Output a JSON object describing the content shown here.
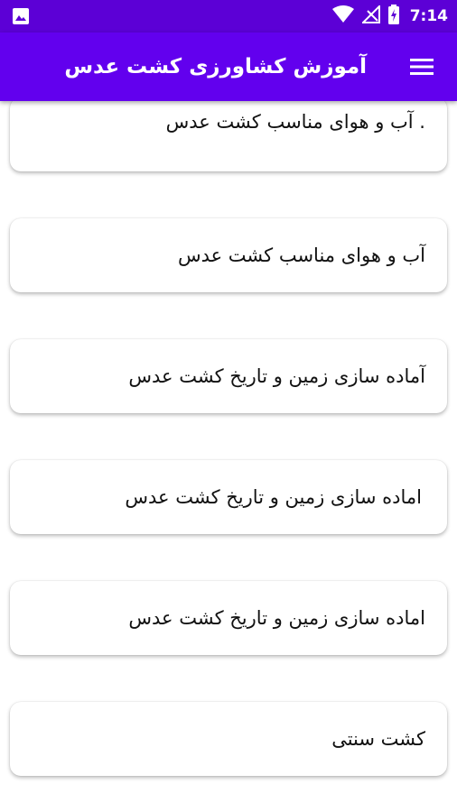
{
  "status_bar": {
    "time": "7:14",
    "icons": [
      "image-icon",
      "wifi-icon",
      "no-signal-icon",
      "battery-charging-icon"
    ]
  },
  "app_bar": {
    "title": "آموزش کشاورزی کشت عدس",
    "menu_icon": "hamburger-menu-icon"
  },
  "items": [
    {
      "label": ". آب و هوای مناسب کشت عدس"
    },
    {
      "label": "آب و هوای مناسب کشت عدس"
    },
    {
      "label": "آماده سازی زمین و تاریخ کشت عدس"
    },
    {
      "label": "اماده سازی زمین و تاریخ کشت عدس"
    },
    {
      "label": "اماده سازی زمین و تاریخ کشت عدس"
    },
    {
      "label": "کشت سنتی"
    }
  ],
  "colors": {
    "status_bar": "#5c00d6",
    "app_bar": "#6200ee",
    "card_background": "#ffffff",
    "text": "#111111"
  }
}
